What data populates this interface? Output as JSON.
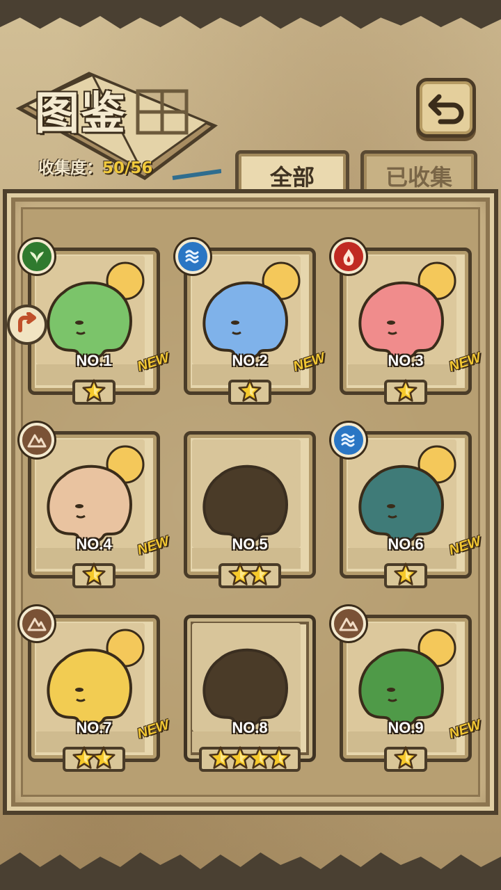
{
  "header": {
    "title": "图鉴",
    "progress_label": "收集度：",
    "progress_value": "50/56"
  },
  "tabs": [
    {
      "label": "全部",
      "active": true
    },
    {
      "label": "已收集",
      "active": false
    }
  ],
  "icons": {
    "back": "return-arrow-icon",
    "side": "scroll-arrow-icon"
  },
  "colors": {
    "grass": "#2f7a2e",
    "water": "#2a76c4",
    "fire": "#c02a22",
    "earth": "#7a5236",
    "new": "#f3c833"
  },
  "cards": [
    {
      "number": "NO.1",
      "element": "grass",
      "stars": 1,
      "new": "NEW",
      "collected": true,
      "color": "#7bc46a"
    },
    {
      "number": "NO.2",
      "element": "water",
      "stars": 1,
      "new": "NEW",
      "collected": true,
      "color": "#7fb2ea"
    },
    {
      "number": "NO.3",
      "element": "fire",
      "stars": 1,
      "new": "NEW",
      "collected": true,
      "color": "#f08c8c"
    },
    {
      "number": "NO.4",
      "element": "earth",
      "stars": 1,
      "new": "NEW",
      "collected": true,
      "color": "#e9c3a0"
    },
    {
      "number": "NO.5",
      "element": "",
      "stars": 2,
      "new": "",
      "collected": false,
      "color": "#4a3b28"
    },
    {
      "number": "NO.6",
      "element": "water",
      "stars": 1,
      "new": "NEW",
      "collected": true,
      "color": "#3f7b78"
    },
    {
      "number": "NO.7",
      "element": "earth",
      "stars": 2,
      "new": "NEW",
      "collected": true,
      "color": "#f2cc52"
    },
    {
      "number": "NO.8",
      "element": "",
      "stars": 4,
      "new": "",
      "collected": false,
      "color": "#4a3b28"
    },
    {
      "number": "NO.9",
      "element": "earth",
      "stars": 1,
      "new": "NEW",
      "collected": true,
      "color": "#4f9a48"
    }
  ]
}
